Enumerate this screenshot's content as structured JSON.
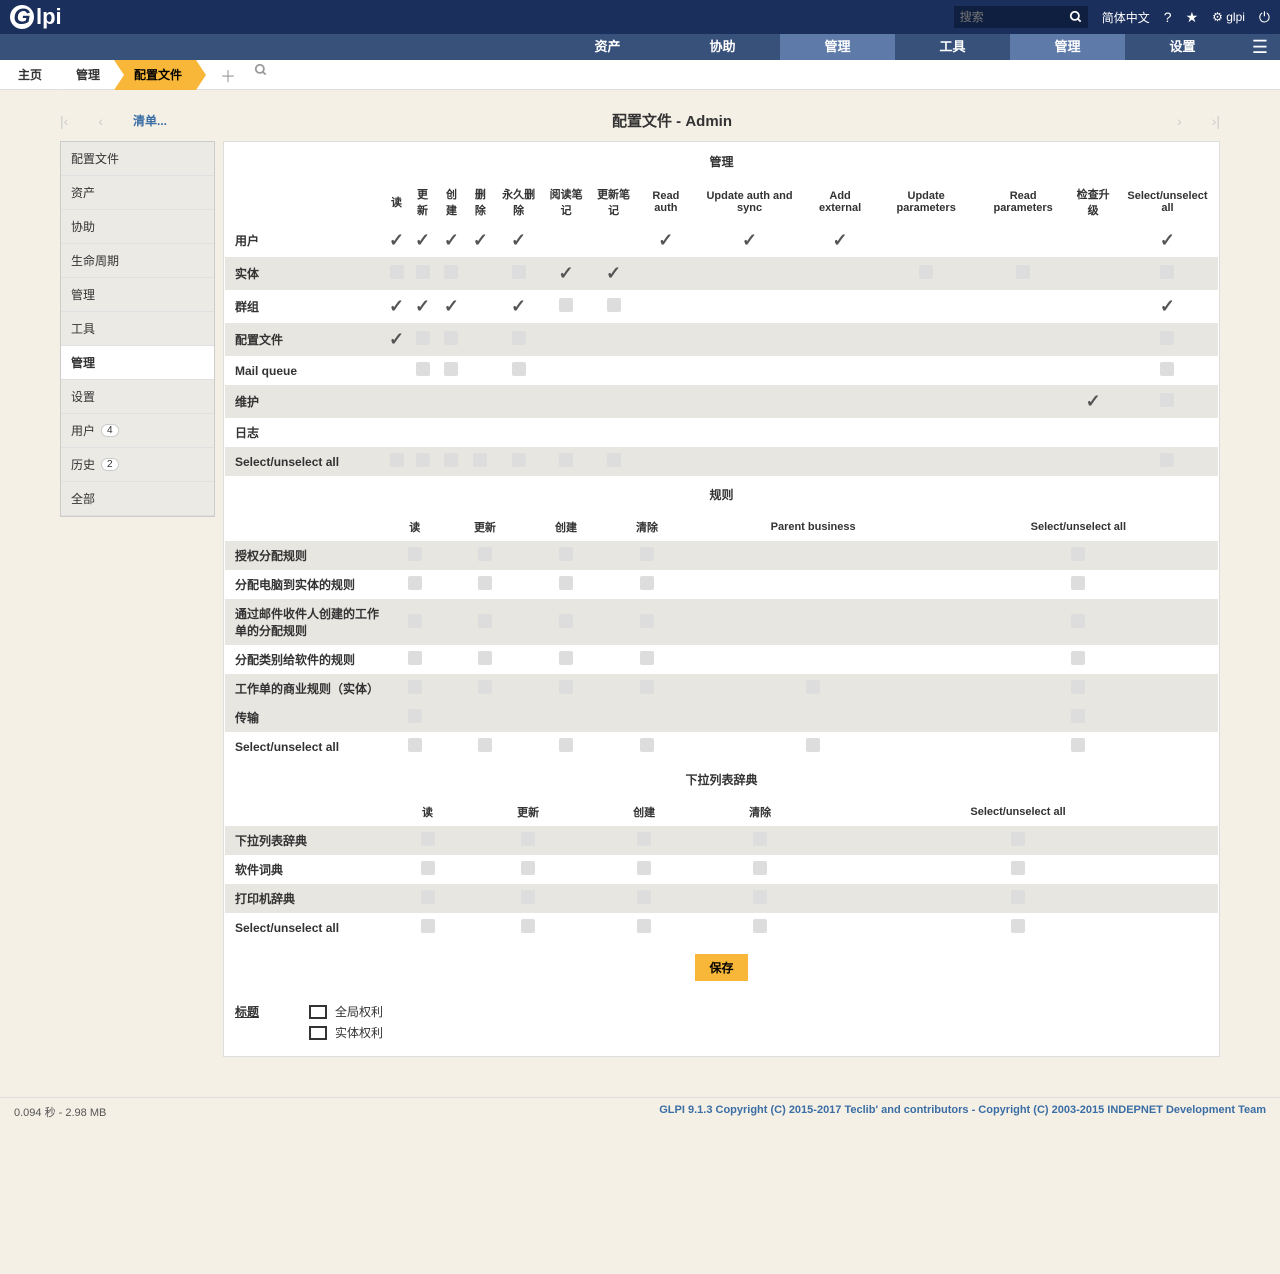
{
  "header": {
    "logo_rest": "lpi",
    "search_placeholder": "搜索",
    "lang": "简体中文",
    "user": "glpi"
  },
  "nav": {
    "items": [
      "资产",
      "协助",
      "管理",
      "工具",
      "管理",
      "设置"
    ],
    "activeIdx": [
      2,
      4
    ],
    "activeRealIdx": 4
  },
  "breadcrumb": {
    "home": "主页",
    "mid": "管理",
    "current": "配置文件"
  },
  "pager": {
    "list": "清单...",
    "title": "配置文件 - Admin"
  },
  "sidebar": {
    "items": [
      {
        "label": "配置文件"
      },
      {
        "label": "资产"
      },
      {
        "label": "协助"
      },
      {
        "label": "生命周期"
      },
      {
        "label": "管理"
      },
      {
        "label": "工具"
      },
      {
        "label": "管理",
        "active": true
      },
      {
        "label": "设置"
      },
      {
        "label": "用户",
        "badge": "4"
      },
      {
        "label": "历史",
        "badge": "2"
      },
      {
        "label": "全部"
      }
    ]
  },
  "section1": {
    "title": "管理",
    "cols": [
      "读",
      "更新",
      "创建",
      "删除",
      "永久删除",
      "阅读笔记",
      "更新笔记",
      "Read auth",
      "Update auth and sync",
      "Add external",
      "Update parameters",
      "Read parameters",
      "检查升级",
      "Select/unselect all"
    ],
    "rows": [
      {
        "label": "用户",
        "cells": [
          "c",
          "c",
          "c",
          "c",
          "c",
          "",
          "",
          "c",
          "c",
          "c",
          "",
          "",
          "",
          "c"
        ],
        "alt": false
      },
      {
        "label": "实体",
        "cells": [
          "b",
          "b",
          "b",
          "",
          "b",
          "c",
          "c",
          "",
          "",
          "",
          "b",
          "b",
          "",
          "b"
        ],
        "alt": true
      },
      {
        "label": "群组",
        "cells": [
          "c",
          "c",
          "c",
          "",
          "c",
          "b",
          "b",
          "",
          "",
          "",
          "",
          "",
          "",
          "c"
        ],
        "alt": false
      },
      {
        "label": "配置文件",
        "cells": [
          "c",
          "b",
          "b",
          "",
          "b",
          "",
          "",
          "",
          "",
          "",
          "",
          "",
          "",
          "b"
        ],
        "alt": true
      },
      {
        "label": "Mail queue",
        "cells": [
          "",
          "b",
          "b",
          "",
          "b",
          "",
          "",
          "",
          "",
          "",
          "",
          "",
          "",
          "b"
        ],
        "alt": false
      },
      {
        "label": "维护",
        "cells": [
          "",
          "",
          "",
          "",
          "",
          "",
          "",
          "",
          "",
          "",
          "",
          "",
          "c",
          "b"
        ],
        "alt": true
      },
      {
        "label": "日志",
        "cells": [
          "",
          "",
          "",
          "",
          "",
          "",
          "",
          "",
          "",
          "",
          "",
          "",
          "",
          ""
        ],
        "alt": false
      },
      {
        "label": "Select/unselect all",
        "cells": [
          "b",
          "b",
          "b",
          "b",
          "b",
          "b",
          "b",
          "",
          "",
          "",
          "",
          "",
          "",
          "b"
        ],
        "alt": true
      }
    ]
  },
  "section2": {
    "title": "规则",
    "cols": [
      "读",
      "更新",
      "创建",
      "清除",
      "Parent business",
      "Select/unselect all"
    ],
    "rows": [
      {
        "label": "授权分配规则",
        "cells": [
          "b",
          "b",
          "b",
          "b",
          "",
          "b"
        ],
        "alt": true
      },
      {
        "label": "分配电脑到实体的规则",
        "cells": [
          "b",
          "b",
          "b",
          "b",
          "",
          "b"
        ],
        "alt": false
      },
      {
        "label": "通过邮件收件人创建的工作单的分配规则",
        "cells": [
          "b",
          "b",
          "b",
          "b",
          "",
          "b"
        ],
        "alt": true
      },
      {
        "label": "分配类别给软件的规则",
        "cells": [
          "b",
          "b",
          "b",
          "b",
          "",
          "b"
        ],
        "alt": false
      },
      {
        "label": "工作单的商业规则（实体）",
        "cells": [
          "b",
          "b",
          "b",
          "b",
          "b",
          "b"
        ],
        "alt": true
      },
      {
        "label": "传输",
        "cells": [
          "b",
          "",
          "",
          "",
          "",
          "b"
        ],
        "alt": true,
        "forceAlt": true
      },
      {
        "label": "Select/unselect all",
        "cells": [
          "b",
          "b",
          "b",
          "b",
          "b",
          "b"
        ],
        "alt": false
      }
    ]
  },
  "section3": {
    "title": "下拉列表辞典",
    "cols": [
      "读",
      "更新",
      "创建",
      "清除",
      "Select/unselect all"
    ],
    "rows": [
      {
        "label": "下拉列表辞典",
        "cells": [
          "b",
          "b",
          "b",
          "b",
          "b"
        ],
        "alt": true
      },
      {
        "label": "软件词典",
        "cells": [
          "b",
          "b",
          "b",
          "b",
          "b"
        ],
        "alt": false
      },
      {
        "label": "打印机辞典",
        "cells": [
          "b",
          "b",
          "b",
          "b",
          "b"
        ],
        "alt": true
      },
      {
        "label": "Select/unselect all",
        "cells": [
          "b",
          "b",
          "b",
          "b",
          "b"
        ],
        "alt": false
      }
    ]
  },
  "save": "保存",
  "legend": {
    "label": "标题",
    "global": "全局权利",
    "entity": "实体权利"
  },
  "footer": {
    "left": "0.094 秒 - 2.98 MB",
    "right": "GLPI 9.1.3 Copyright (C) 2015-2017 Teclib' and contributors - Copyright (C) 2003-2015 INDEPNET Development Team"
  }
}
